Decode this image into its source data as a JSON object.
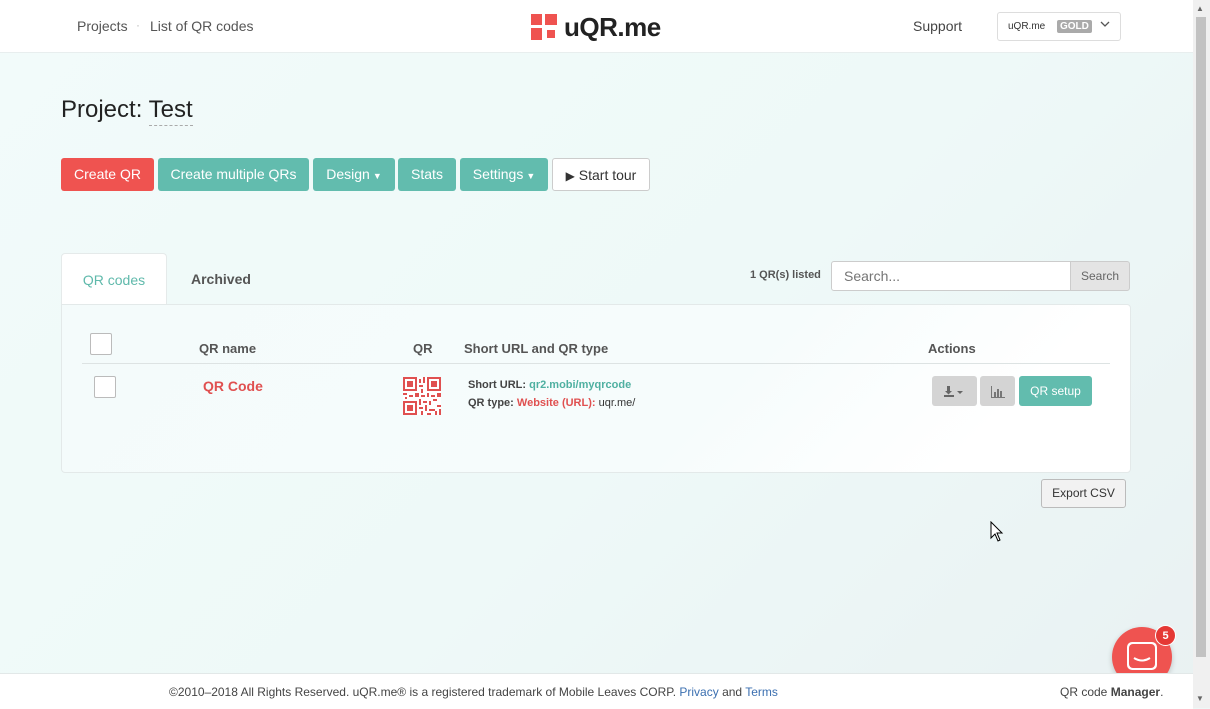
{
  "nav": {
    "breadcrumb_projects": "Projects",
    "breadcrumb_separator": "·",
    "breadcrumb_list": "List of QR codes",
    "logo_text": "uQR.me",
    "support": "Support",
    "account_name": "uQR.me",
    "account_badge": "GOLD"
  },
  "project": {
    "label": "Project:",
    "name": "Test"
  },
  "toolbar": {
    "create_qr": "Create QR",
    "create_multiple": "Create multiple QRs",
    "design": "Design",
    "stats": "Stats",
    "settings": "Settings",
    "start_tour": "Start tour"
  },
  "tabs": {
    "qr_codes": "QR codes",
    "archived": "Archived"
  },
  "listing": {
    "count_text": "1 QR(s) listed",
    "search_placeholder": "Search...",
    "search_button": "Search"
  },
  "table": {
    "headers": {
      "name": "QR name",
      "qr": "QR",
      "url": "Short URL and QR type",
      "actions": "Actions"
    },
    "rows": [
      {
        "name": "QR Code",
        "short_url_label": "Short URL:",
        "short_url": "qr2.mobi/myqrcode",
        "type_label": "QR type:",
        "type_value": "Website (URL):",
        "type_target": "uqr.me/",
        "setup_button": "QR setup"
      }
    ]
  },
  "export_button": "Export CSV",
  "footer": {
    "copyright": "©2010–2018 All Rights Reserved. uQR.me® is a registered trademark of Mobile Leaves CORP.",
    "privacy": "Privacy",
    "and": "and",
    "terms": "Terms",
    "brand_prefix": "QR code",
    "brand_bold": "Manager",
    "brand_suffix": "."
  },
  "chat": {
    "badge_count": "5"
  },
  "colors": {
    "brand_red": "#ef5350",
    "teal": "#62bcae",
    "link_teal": "#4fb0a1"
  },
  "icons": {
    "logo": "uqr-logo-icon",
    "chevron": "chevron-down-icon",
    "caret": "caret-down-icon",
    "play": "play-icon",
    "download": "download-icon",
    "stats": "bar-chart-icon",
    "chat": "chat-icon",
    "cursor": "mouse-cursor-icon"
  }
}
